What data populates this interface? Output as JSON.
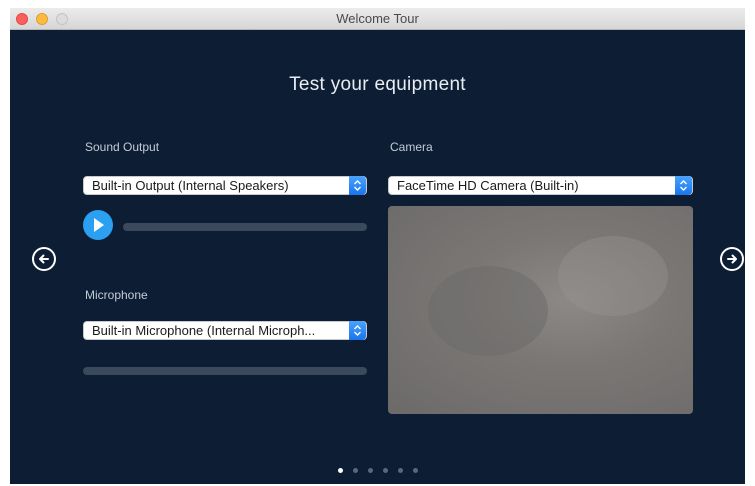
{
  "window": {
    "title": "Welcome Tour"
  },
  "page": {
    "heading": "Test your equipment",
    "pagination": {
      "count": 6,
      "active_index": 0
    }
  },
  "sound_output": {
    "label": "Sound Output",
    "selected": "Built-in Output (Internal Speakers)",
    "play_icon": "play-icon"
  },
  "microphone": {
    "label": "Microphone",
    "selected": "Built-in Microphone (Internal Microph..."
  },
  "camera": {
    "label": "Camera",
    "selected": "FaceTime HD Camera (Built-in)"
  },
  "navigation": {
    "back_icon": "arrow-left-circle-icon",
    "next_icon": "arrow-right-circle-icon"
  },
  "colors": {
    "background": "#0d1d33",
    "accent": "#2b9ff0"
  }
}
